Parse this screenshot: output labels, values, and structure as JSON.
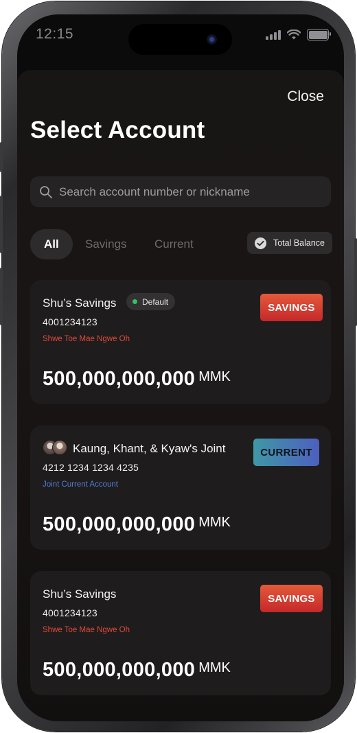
{
  "status_bar": {
    "time": "12:15"
  },
  "header": {
    "close_label": "Close",
    "title": "Select Account"
  },
  "search": {
    "placeholder": "Search account number or nickname",
    "value": ""
  },
  "filters": {
    "tabs": [
      {
        "label": "All",
        "active": true
      },
      {
        "label": "Savings",
        "active": false
      },
      {
        "label": "Current",
        "active": false
      }
    ],
    "total_balance_label": "Total Balance",
    "total_balance_checked": true
  },
  "accounts": [
    {
      "name": "Shu’s Savings",
      "default_badge": "Default",
      "number": "4001234123",
      "subtitle": "Shwe Toe Mae Ngwe Oh",
      "type_label": "SAVINGS",
      "balance": "500,000,000,000",
      "currency": "MMK"
    },
    {
      "name": "Kaung, Khant, & Kyaw's Joint",
      "number": "4212 1234 1234 4235",
      "subtitle": "Joint Current Account",
      "type_label": "CURRENT",
      "balance": "500,000,000,000",
      "currency": "MMK"
    },
    {
      "name": "Shu’s Savings",
      "number": "4001234123",
      "subtitle": "Shwe Toe Mae Ngwe Oh",
      "type_label": "SAVINGS",
      "balance": "500,000,000,000",
      "currency": "MMK"
    }
  ],
  "colors": {
    "sheet_background": "#181515",
    "card_background": "#1f1c1d",
    "savings_tag": "#d8432f",
    "current_tag_start": "#3f98a6",
    "current_tag_end": "#4d5fc0",
    "savings_subtitle": "#e04a3a",
    "joint_subtitle": "#4f7fd6",
    "default_dot": "#2fc26a"
  }
}
